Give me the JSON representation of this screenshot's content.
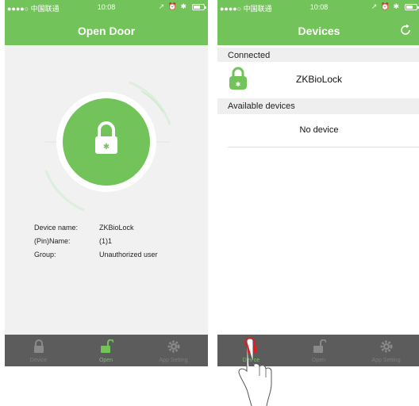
{
  "status_bar": {
    "carrier": "●●●●○ 中国联通",
    "time": "10:08",
    "icons": "↗ ⏰ ✱"
  },
  "screen_open": {
    "title": "Open Door",
    "info": [
      {
        "label": "Device name:",
        "value": "ZKBioLock"
      },
      {
        "label": "(Pin)Name:",
        "value": "(1)1"
      },
      {
        "label": "Group:",
        "value": "Unauthorized user"
      }
    ]
  },
  "screen_devices": {
    "title": "Devices",
    "connected_header": "Connected",
    "connected_device": "ZKBioLock",
    "available_header": "Available devices",
    "no_device_text": "No device"
  },
  "tabbar": {
    "tabs": [
      {
        "label": "Device",
        "icon": "lock-icon"
      },
      {
        "label": "Open",
        "icon": "unlock-icon"
      },
      {
        "label": "App Setting",
        "icon": "gear-icon"
      }
    ]
  },
  "colors": {
    "brand_green": "#73c35b",
    "tabbar_gray": "#5c5c5c",
    "touch_red": "#e02020"
  }
}
